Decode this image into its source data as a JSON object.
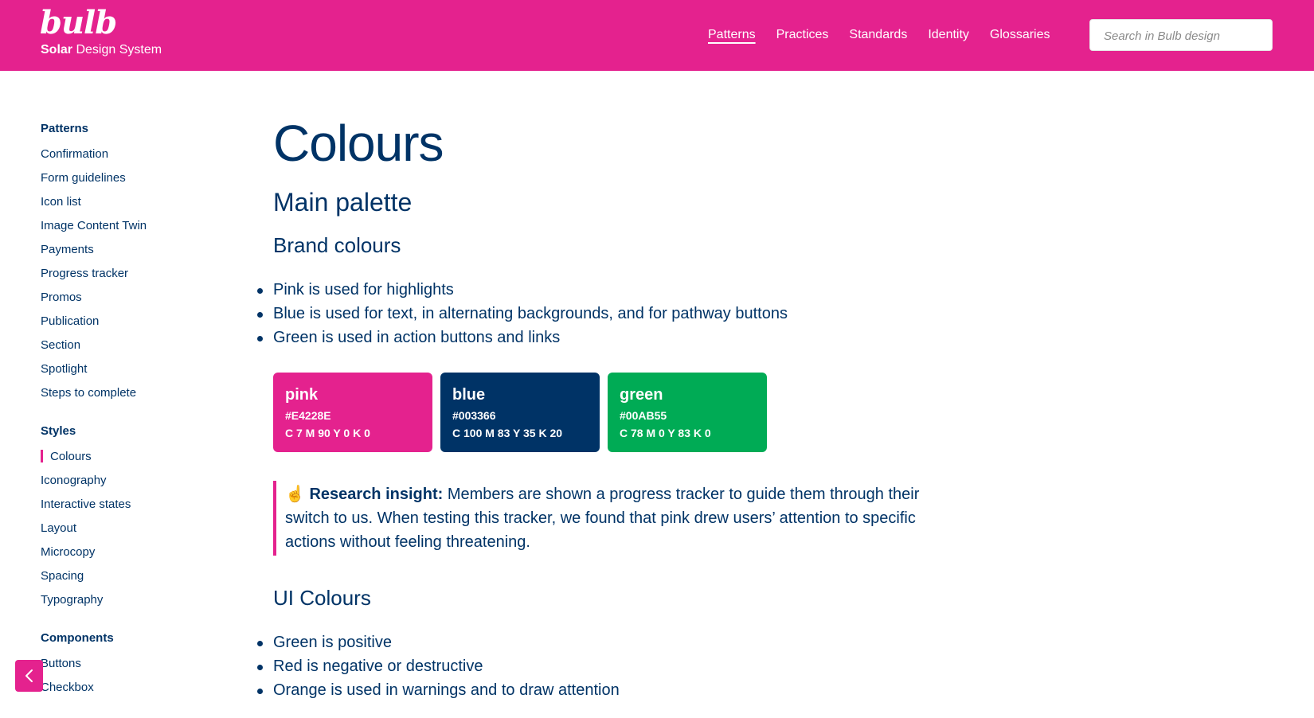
{
  "header": {
    "logo_text": "bulb",
    "subtitle_bold": "Solar",
    "subtitle_rest": " Design System",
    "nav": [
      "Patterns",
      "Practices",
      "Standards",
      "Identity",
      "Glossaries"
    ],
    "active_nav": "Patterns",
    "search_placeholder": "Search in Bulb design",
    "background_color": "#E4228E"
  },
  "sidebar": {
    "groups": [
      {
        "title": "Patterns",
        "items": [
          "Confirmation",
          "Form guidelines",
          "Icon list",
          "Image Content Twin",
          "Payments",
          "Progress tracker",
          "Promos",
          "Publication",
          "Section",
          "Spotlight",
          "Steps to complete"
        ]
      },
      {
        "title": "Styles",
        "items": [
          "Colours",
          "Iconography",
          "Interactive states",
          "Layout",
          "Microcopy",
          "Spacing",
          "Typography"
        ]
      },
      {
        "title": "Components",
        "items": [
          "Buttons",
          "Checkbox"
        ]
      }
    ],
    "active_item": "Colours",
    "collapse_icon": "chevron-left-icon"
  },
  "main": {
    "title": "Colours",
    "section_title": "Main palette",
    "brand_heading": "Brand colours",
    "brand_bullets": [
      "Pink is used for highlights",
      "Blue is used for text, in alternating backgrounds, and for pathway buttons",
      "Green is used in action buttons and links"
    ],
    "swatches": [
      {
        "name": "pink",
        "hex": "#E4228E",
        "cmyk": "C 7 M 90 Y 0 K 0",
        "color": "#E4228E"
      },
      {
        "name": "blue",
        "hex": "#003366",
        "cmyk": "C 100 M 83 Y 35 K 20",
        "color": "#003366"
      },
      {
        "name": "green",
        "hex": "#00AB55",
        "cmyk": "C 78 M 0 Y 83 K 0",
        "color": "#00AB55"
      }
    ],
    "insight": {
      "icon": "pointing-up-hand-icon",
      "icon_glyph": "☝",
      "title": "Research insight:",
      "text": " Members are shown a progress tracker to guide them through their switch to us. When testing this tracker, we found that pink drew users’ attention to specific actions without feeling threatening."
    },
    "ui_heading": "UI Colours",
    "ui_bullets": [
      "Green is positive",
      "Red is negative or destructive",
      "Orange is used in warnings and to draw attention"
    ]
  }
}
